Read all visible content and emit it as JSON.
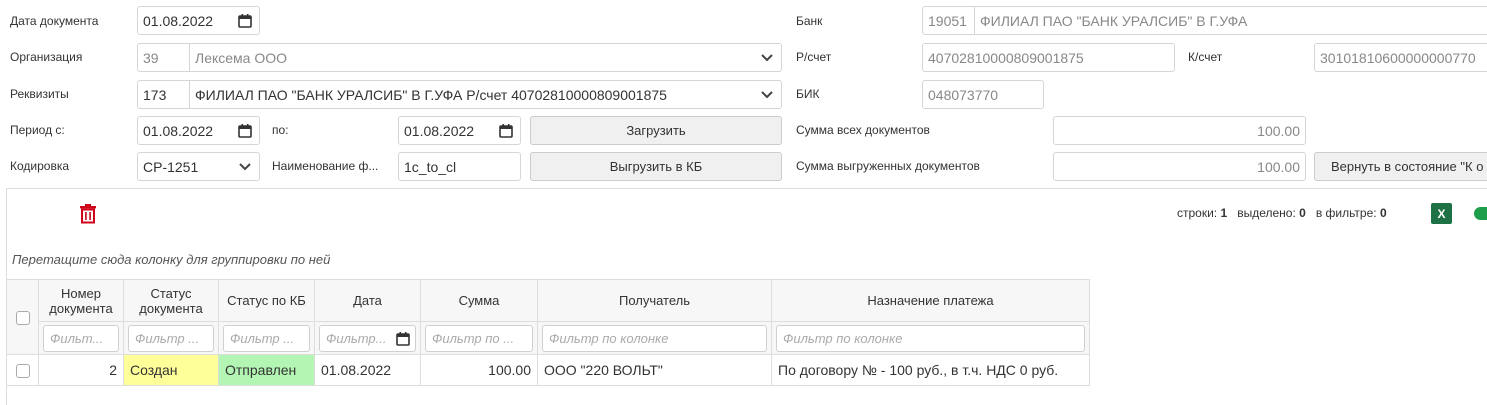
{
  "form": {
    "doc_date_label": "Дата документа",
    "doc_date_value": "01.08.2022",
    "org_label": "Организация",
    "org_code": "39",
    "org_name": "Лексема ООО",
    "req_label": "Реквизиты",
    "req_code": "173",
    "req_value": "ФИЛИАЛ ПАО \"БАНК УРАЛСИБ\" В Г.УФА Р/счет 40702810000809001875",
    "period_label": "Период с:",
    "period_from": "01.08.2022",
    "period_to_label": "по:",
    "period_to": "01.08.2022",
    "load_button": "Загрузить",
    "encoding_label": "Кодировка",
    "encoding_value": "CP-1251",
    "filename_label": "Наименование ф...",
    "filename_value": "1c_to_cl",
    "export_button": "Выгрузить в КБ",
    "bank_label": "Банк",
    "bank_code": "19051",
    "bank_name": "ФИЛИАЛ ПАО \"БАНК УРАЛСИБ\" В Г.УФА",
    "account_label": "Р/счет",
    "account_value": "40702810000809001875",
    "corr_label": "К/счет",
    "corr_value": "30101810600000000770",
    "bik_label": "БИК",
    "bik_value": "048073770",
    "sum_all_label": "Сумма всех документов",
    "sum_all_value": "100.00",
    "sum_exported_label": "Сумма выгруженных документов",
    "sum_exported_value": "100.00",
    "revert_button": "Вернуть в состояние \"К о"
  },
  "toolbar": {
    "rows_label": "строки:",
    "rows_value": "1",
    "selected_label": "выделено:",
    "selected_value": "0",
    "filtered_label": "в фильтре:",
    "filtered_value": "0",
    "excel_label": "X"
  },
  "grid": {
    "group_hint": "Перетащите сюда колонку для группировки по ней",
    "columns": [
      {
        "title": "Номер документа",
        "filter": "Фильт..."
      },
      {
        "title": "Статус документа",
        "filter": "Фильтр ..."
      },
      {
        "title": "Статус по КБ",
        "filter": "Фильтр ..."
      },
      {
        "title": "Дата",
        "filter": "Фильтр..."
      },
      {
        "title": "Сумма",
        "filter": "Фильтр по ..."
      },
      {
        "title": "Получатель",
        "filter": "Фильтр по колонке"
      },
      {
        "title": "Назначение платежа",
        "filter": "Фильтр по колонке"
      }
    ],
    "rows": [
      {
        "number": "2",
        "status": "Создан",
        "kb_status": "Отправлен",
        "date": "01.08.2022",
        "sum": "100.00",
        "recipient": "ООО \"220 ВОЛЬТ\"",
        "purpose": "По договору № - 100 руб., в т.ч. НДС 0 руб."
      }
    ]
  },
  "colors": {
    "status_created": "#ffff99",
    "status_sent": "#b3f5b3",
    "trash": "#d0021b",
    "excel": "#1e7145"
  }
}
